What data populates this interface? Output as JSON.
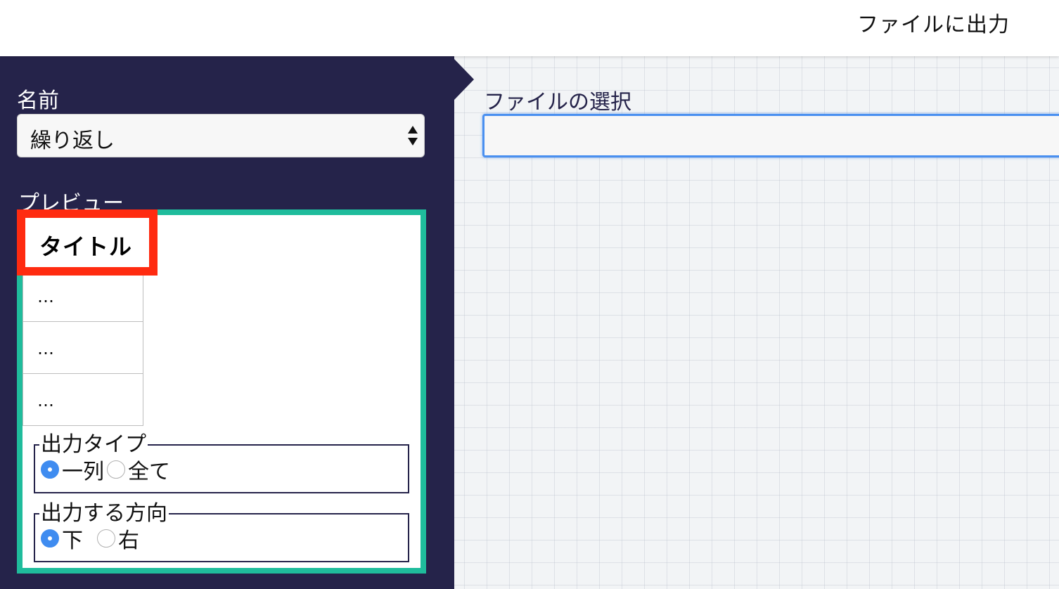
{
  "header": {
    "title": "ファイルに出力"
  },
  "sidebar": {
    "name_label": "名前",
    "name_select": {
      "selected": "繰り返し"
    },
    "preview_label": "プレビュー",
    "preview": {
      "title_cell": "タイトル",
      "cells": [
        "…",
        "…",
        "…"
      ],
      "output_type": {
        "legend": "出力タイプ",
        "options": [
          "一列",
          "全て"
        ],
        "selected": "一列"
      },
      "output_direction": {
        "legend": "出力する方向",
        "options": [
          "下",
          "右"
        ],
        "selected": "下"
      }
    }
  },
  "main": {
    "file_label": "ファイルの選択",
    "file_input": {
      "value": ""
    }
  },
  "colors": {
    "sidebar_bg": "#25234a",
    "preview_border": "#1fbc9c",
    "highlight_border": "#ff2b10",
    "radio_checked": "#3f8cf0",
    "input_focus": "#4a90f0"
  }
}
